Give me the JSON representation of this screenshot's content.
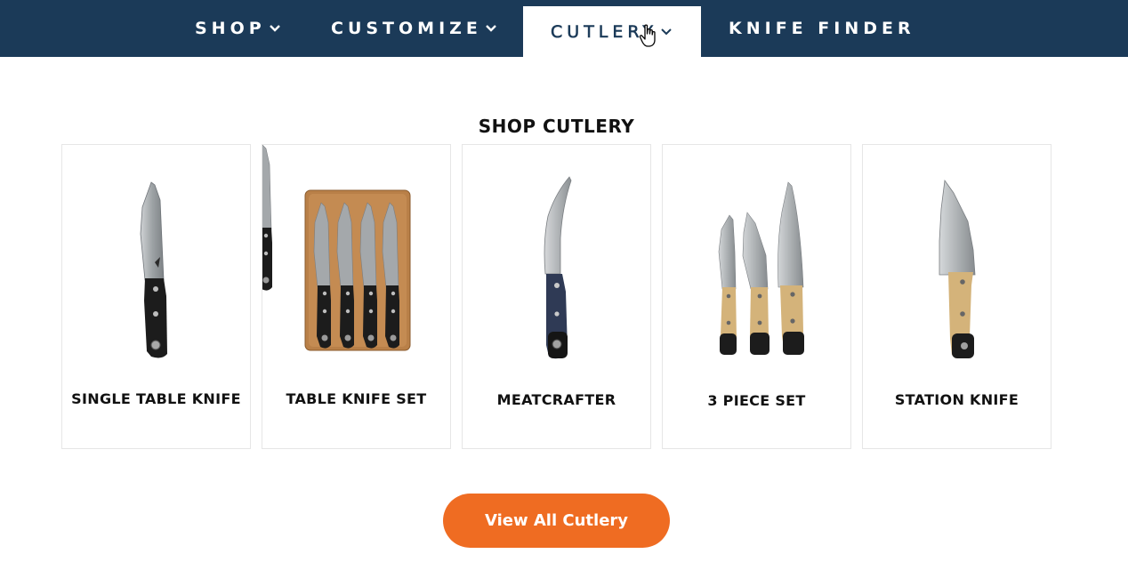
{
  "nav": {
    "items": [
      {
        "label": "SHOP",
        "has_dropdown": true
      },
      {
        "label": "CUSTOMIZE",
        "has_dropdown": true
      },
      {
        "label": "CUTLERY",
        "has_dropdown": true,
        "active": true
      },
      {
        "label": "KNIFE FINDER",
        "has_dropdown": false
      }
    ]
  },
  "section": {
    "title": "SHOP CUTLERY"
  },
  "products": [
    {
      "name": "SINGLE TABLE KNIFE",
      "icon": "single-table-knife-image"
    },
    {
      "name": "TABLE KNIFE SET",
      "icon": "table-knife-set-image"
    },
    {
      "name": "MEATCRAFTER",
      "icon": "meatcrafter-knife-image"
    },
    {
      "name": "3 PIECE SET",
      "icon": "three-piece-set-image"
    },
    {
      "name": "STATION KNIFE",
      "icon": "station-knife-image"
    }
  ],
  "cta": {
    "label": "View All Cutlery"
  },
  "colors": {
    "nav_bg": "#1b3a58",
    "cta_bg": "#ef6c22",
    "card_border": "#e6e6e6",
    "blade": "#a9adb0",
    "handle_black": "#1c1c1c",
    "handle_tan": "#d4b37a",
    "handle_navy": "#2f3a55",
    "wood_tray": "#b98048"
  }
}
